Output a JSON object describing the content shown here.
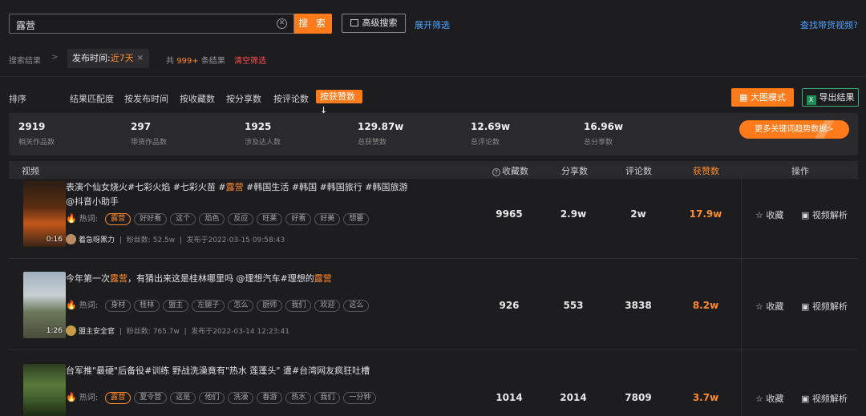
{
  "search": {
    "query": "露营",
    "button": "搜 索",
    "advanced": "高级搜索",
    "expand_filter": "展开筛选",
    "find_goods": "查找带货视频?"
  },
  "filter": {
    "label": "搜索结果",
    "sep": ">",
    "chip_key": "发布时间:",
    "chip_value": "近7天",
    "chip_close": "×",
    "total_prefix": "共",
    "total_num": "999+",
    "total_suffix": "条结果",
    "clear": "清空筛选"
  },
  "sort": {
    "label": "排序",
    "items": [
      "结果匹配度",
      "按发布时间",
      "按收藏数",
      "按分享数",
      "按评论数"
    ],
    "active": "按获赞数↓",
    "big_mode": "大图模式",
    "export": "导出结果",
    "xls_icon": "X"
  },
  "stats": [
    {
      "value": "2919",
      "label": "相关作品数"
    },
    {
      "value": "297",
      "label": "带货作品数"
    },
    {
      "value": "1925",
      "label": "涉及达人数"
    },
    {
      "value": "129.87w",
      "label": "总获赞数"
    },
    {
      "value": "12.69w",
      "label": "总评论数"
    },
    {
      "value": "16.96w",
      "label": "总分享数"
    }
  ],
  "trend_button": "更多关键词趋势数据>",
  "table": {
    "headers": {
      "video": "视频",
      "collect": "收藏数",
      "share": "分享数",
      "comment": "评论数",
      "like": "获赞数",
      "action": "操作"
    },
    "hot_label": "热词:",
    "fans_label": "粉丝数:",
    "collect_action": "☆ 收藏",
    "parse_action": "视频解析",
    "rows": [
      {
        "title_pre": "表演个仙女烧火#七彩火焰 #七彩火苗 #",
        "title_kw": "露营",
        "title_post": " #韩国生活 #韩国 #韩国旅行 #韩国旅游 @抖音小助手",
        "duration": "0:16",
        "tags": [
          "露营",
          "好好看",
          "这个",
          "焰色",
          "反应",
          "旺莱",
          "好看",
          "好美",
          "想要"
        ],
        "author": "着急呀黑力",
        "fans": "52.5w",
        "published": "发布于2022-03-15 09:58:43",
        "collect": "9965",
        "share": "2.9w",
        "comment": "2w",
        "like": "17.9w"
      },
      {
        "title_pre": "今年第一次",
        "title_kw": "露营",
        "title_post": "，有猜出来这是桂林哪里吗 @理想汽车#理想的",
        "title_kw2": "露营",
        "duration": "1:26",
        "tags": [
          "身材",
          "桂林",
          "盟主",
          "左腿子",
          "怎么",
          "厨师",
          "我们",
          "欢迎",
          "这么"
        ],
        "author": "盟主安全官",
        "fans": "765.7w",
        "published": "发布于2022-03-14 12:23:41",
        "collect": "926",
        "share": "553",
        "comment": "3838",
        "like": "8.2w"
      },
      {
        "title_pre": "台军推\"最硬\"后备役#训练 野战洗澡竟有\"热水 莲蓬头\" 遭#台湾网友疯狂吐槽",
        "title_kw": "",
        "title_post": "",
        "duration": "",
        "tags": [
          "露营",
          "夏令营",
          "这是",
          "他们",
          "洗澡",
          "春游",
          "热水",
          "我们",
          "一分钟"
        ],
        "author": "",
        "fans": "",
        "published": "",
        "collect": "1014",
        "share": "2014",
        "comment": "7809",
        "like": "3.7w"
      }
    ]
  },
  "colors": {
    "accent": "#ff7a1a",
    "link": "#4da3ff",
    "bg": "#1d1d20",
    "panel": "#2a2a2e"
  }
}
